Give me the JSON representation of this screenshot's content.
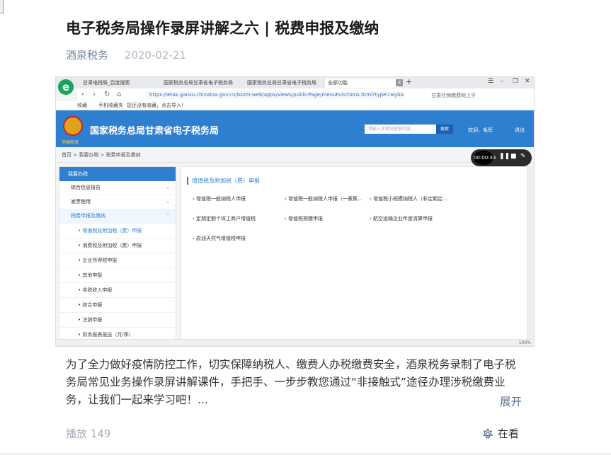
{
  "article": {
    "title": "电子税务局操作录屏讲解之六 | 税费申报及缴纳",
    "author": "酒泉税务",
    "date": "2020-02-21",
    "description": "为了全力做好疫情防控工作，切实保障纳税人、缴费人办税缴费安全，酒泉税务录制了电子税务局常见业务操作录屏讲解课件，手把手、一步步教您通过“非接触式”途径办理涉税缴费业务，让我们一起来学习吧！...",
    "expand_label": "展开",
    "plays_label": "播放 149",
    "watch_label": "在看"
  },
  "screenshot": {
    "tabs": [
      "甘肃电税局_百度搜索",
      "国家税务总局甘肃省电子税务局",
      "国家税务总局甘肃省电子税务局",
      "全部功能"
    ],
    "url": "https://etax.gansu.chinatax.gov.cn/bszm-web/apps/views/publicPage/menuFunctions.html?type=wybs&s",
    "addr_search": "甘肃社保缴费网上平",
    "bookmarks": [
      "收藏",
      "手机收藏夹",
      "您还没有收藏，点击导入！"
    ],
    "emblem_sub": "中国税务",
    "site_title": "国家税务总局甘肃省电子税务局",
    "search_placeholder": "请输入关键词搜索内容",
    "search_button": "搜索",
    "welcome": "欢迎，毛晖",
    "logout": "退出",
    "breadcrumb": "首页 > 我要办税 > 税费申报及缴纳",
    "timer": "00:00:33",
    "sidebar_head": "我要办税",
    "sidebar_groups": [
      "综合信息报告",
      "发票使用",
      "税费申报及缴纳"
    ],
    "sidebar_subitems": [
      "增值税及附加税（费）申报",
      "消费税及附加税（费）申报",
      "企业所得税申报",
      "其他申报",
      "非税收入申报",
      "综合申报",
      "注销申报",
      "财务报表报送（月/季）"
    ],
    "content_head": "增值税及附加税（费）申报",
    "functions": [
      "增值税一般纳税人申报",
      "增值税一般纳税人申报（一表集…",
      "增值税小规模纳税人（非定期定…",
      "定期定额个体工商户增值税",
      "增值税预缴申报",
      "航空运输企业年度清算申报",
      "原油天然气增值税申报"
    ],
    "zoom": "100%"
  },
  "colors": {
    "brand_blue": "#2f7fd1",
    "link_gray": "#5a6f93"
  }
}
